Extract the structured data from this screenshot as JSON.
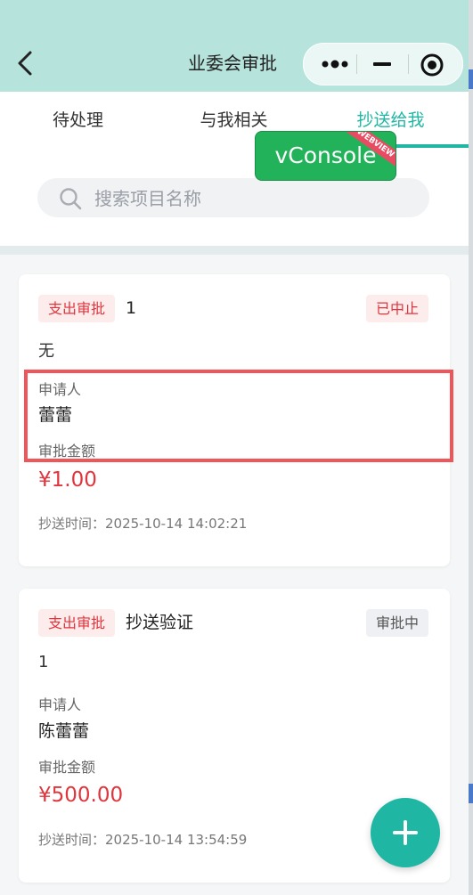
{
  "header": {
    "title": "业委会审批"
  },
  "tabs": [
    {
      "label": "待处理",
      "active": false
    },
    {
      "label": "与我相关",
      "active": false
    },
    {
      "label": "抄送给我",
      "active": true
    }
  ],
  "search": {
    "placeholder": "搜索项目名称",
    "value": ""
  },
  "vconsole": {
    "label": "vConsole",
    "ribbon": "WEBVIEW"
  },
  "cards": [
    {
      "type_tag": "支出审批",
      "title": "1",
      "status": "已中止",
      "description": "无",
      "applicant_label": "申请人",
      "applicant": "蕾蕾",
      "amount_label": "审批金额",
      "amount": "¥1.00",
      "cc_time": "抄送时间：2025-10-14 14:02:21"
    },
    {
      "type_tag": "支出审批",
      "title": "抄送验证",
      "status": "审批中",
      "description": "1",
      "applicant_label": "申请人",
      "applicant": "陈蕾蕾",
      "amount_label": "审批金额",
      "amount": "¥500.00",
      "cc_time": "抄送时间：2025-10-14 13:54:59"
    }
  ],
  "colors": {
    "accent": "#1fb7a3",
    "header_bg": "#b6e3dc",
    "danger": "#e0353d",
    "highlight": "#f0555a"
  }
}
